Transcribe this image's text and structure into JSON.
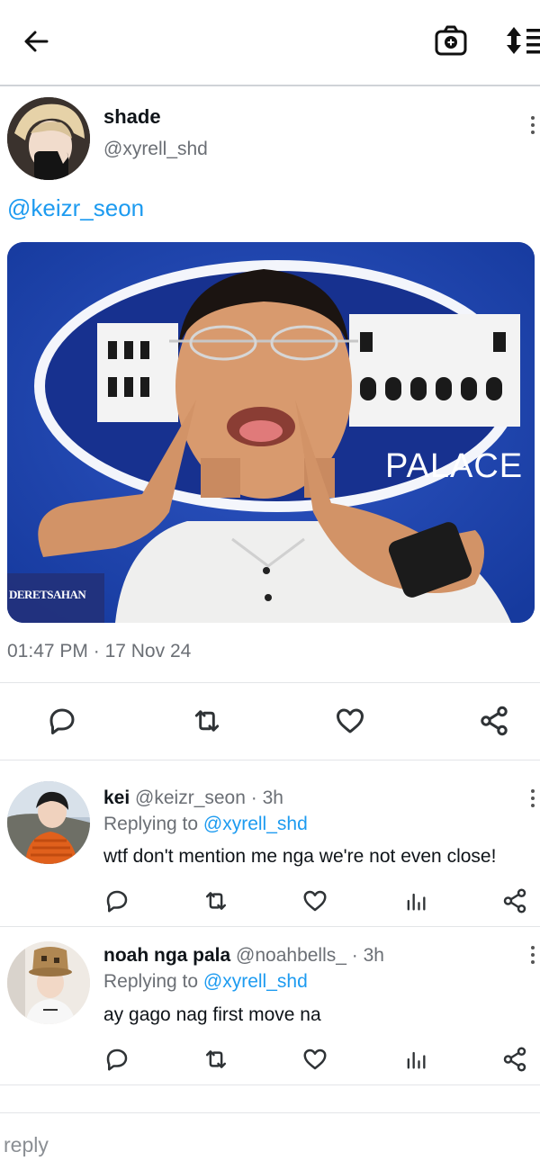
{
  "post": {
    "display_name": "shade",
    "handle": "@xyrell_shd",
    "mention": "@keizr_seon",
    "meta_time": "01:47 PM",
    "meta_sep": "·",
    "meta_date": "17 Nov 24",
    "image": {
      "tv_tag": "DERETSAHAN",
      "backdrop_text": "PALACE"
    }
  },
  "replies": [
    {
      "display_name": "kei",
      "handle": "@keizr_seon",
      "time": "· 3h",
      "replying_prefix": "Replying to",
      "replying_to": "@xyrell_shd",
      "text": "wtf don't mention me nga we're not even close!"
    },
    {
      "display_name": "noah nga pala",
      "handle": "@noahbells_",
      "time": "· 3h",
      "replying_prefix": "Replying to",
      "replying_to": "@xyrell_shd",
      "text": "ay gago nag first move na"
    }
  ],
  "composer": {
    "placeholder": "reply"
  },
  "colors": {
    "accent": "#1d9bf0",
    "text": "#0f1419",
    "muted": "#6b6f75",
    "divider": "#e3e5e8"
  }
}
